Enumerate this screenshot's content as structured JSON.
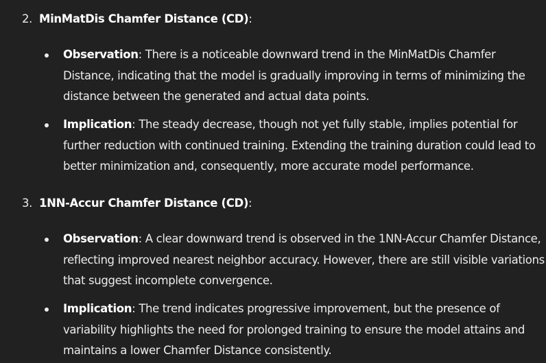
{
  "sections": [
    {
      "number": "2.",
      "title": "MinMatDis Chamfer Distance (CD)",
      "colon": ":",
      "bullets": [
        {
          "label": "Observation",
          "text": ": There is a noticeable downward trend in the MinMatDis Chamfer Distance, indicating that the model is gradually improving in terms of minimizing the distance between the generated and actual data points."
        },
        {
          "label": "Implication",
          "text": ": The steady decrease, though not yet fully stable, implies potential for further reduction with continued training. Extending the training duration could lead to better minimization and, consequently, more accurate model performance."
        }
      ]
    },
    {
      "number": "3.",
      "title": "1NN-Accur Chamfer Distance (CD)",
      "colon": ":",
      "bullets": [
        {
          "label": "Observation",
          "text": ": A clear downward trend is observed in the 1NN-Accur Chamfer Distance, reflecting improved nearest neighbor accuracy. However, there are still visible variations that suggest incomplete convergence."
        },
        {
          "label": "Implication",
          "text": ": The trend indicates progressive improvement, but the presence of variability highlights the need for prolonged training to ensure the model attains and maintains a lower Chamfer Distance consistently."
        }
      ]
    }
  ],
  "colors": {
    "background": "#212121",
    "text": "#ececec",
    "bold_text": "#ffffff"
  }
}
